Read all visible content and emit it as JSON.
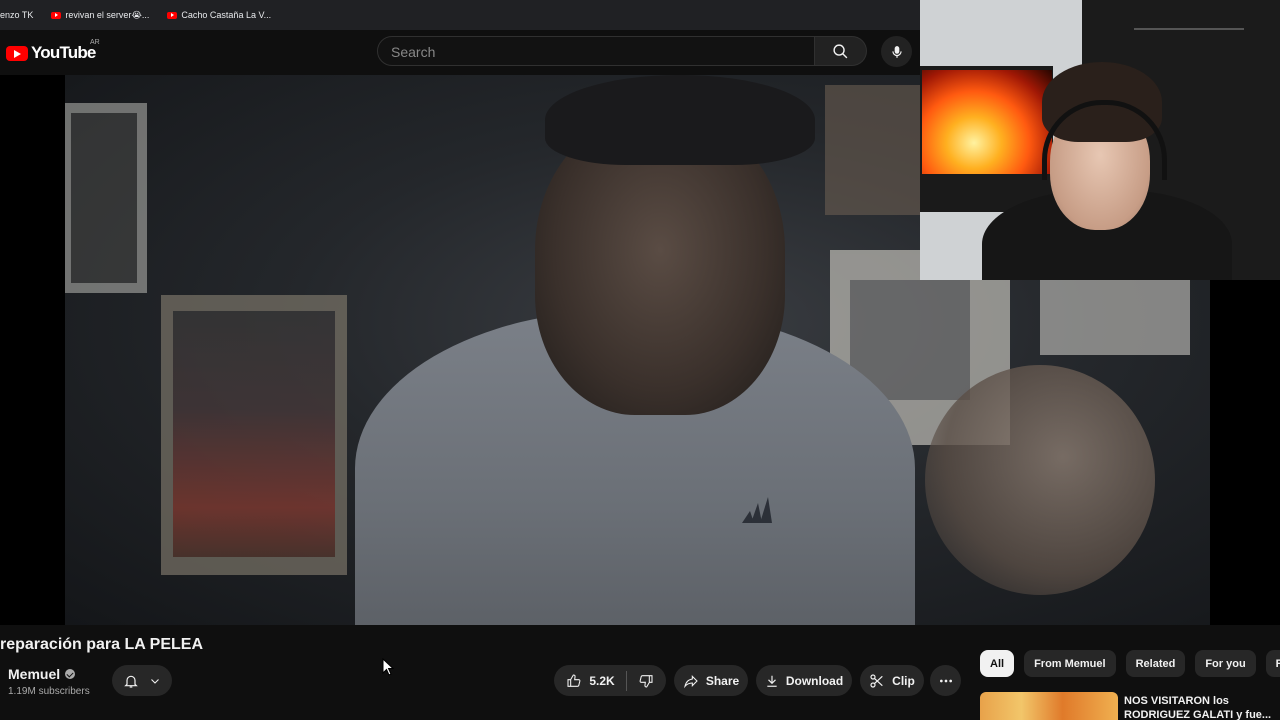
{
  "bookmarks": [
    {
      "label": "enzo TK",
      "has_icon": false
    },
    {
      "label": "revivan el server😭...",
      "has_icon": true
    },
    {
      "label": "Cacho Castaña La V...",
      "has_icon": true
    }
  ],
  "masthead": {
    "logo_text": "YouTube",
    "country_code": "AR",
    "search_placeholder": "Search"
  },
  "video": {
    "title": "reparación para LA PELEA",
    "channel_name": "Memuel",
    "subscribers": "1.19M subscribers",
    "like_count": "5.2K"
  },
  "actions": {
    "share": "Share",
    "download": "Download",
    "clip": "Clip"
  },
  "chips": [
    {
      "label": "All",
      "active": true
    },
    {
      "label": "From Memuel",
      "active": false
    },
    {
      "label": "Related",
      "active": false
    },
    {
      "label": "For you",
      "active": false
    },
    {
      "label": "R",
      "active": false
    }
  ],
  "recommendation": {
    "title": "NOS VISITARON los RODRIGUEZ GALATI y fue..."
  },
  "icons": [
    "youtube-logo-icon",
    "search-icon",
    "mic-icon",
    "bell-icon",
    "chevron-down-icon",
    "like-icon",
    "dislike-icon",
    "share-icon",
    "download-icon",
    "clip-icon",
    "more-icon"
  ],
  "colors": {
    "brand": "#ff0000",
    "background": "#0f0f0f",
    "chip_bg": "#272727"
  }
}
